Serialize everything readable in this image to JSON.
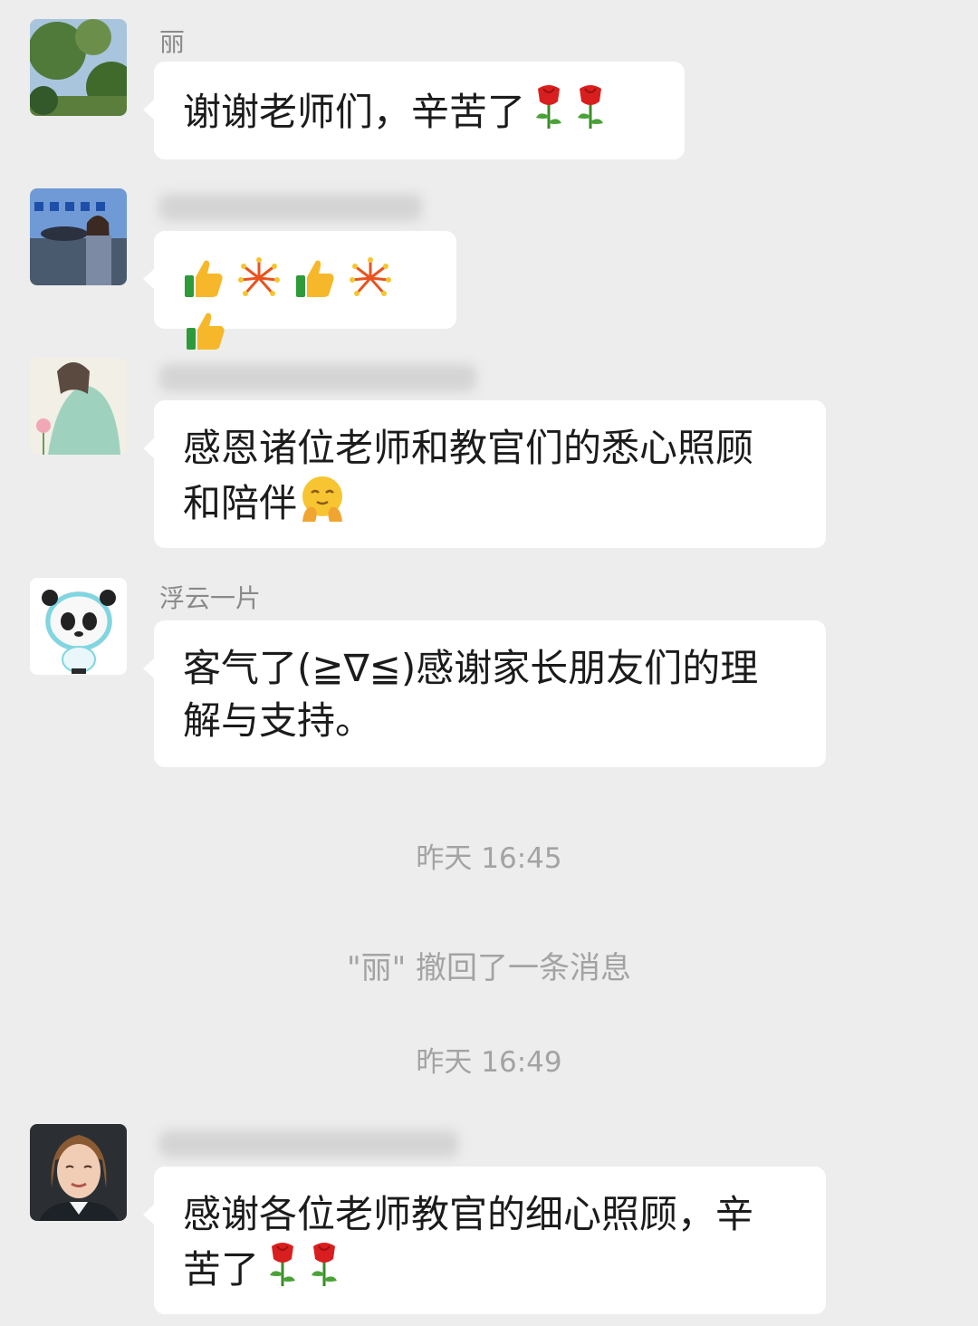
{
  "messages": [
    {
      "sender": "丽",
      "text": "谢谢老师们，辛苦了",
      "emojis": [
        "rose-emoji",
        "rose-emoji"
      ]
    },
    {
      "sender": "",
      "text": "",
      "emojis": [
        "thumbs-up-emoji",
        "fireworks-emoji",
        "thumbs-up-emoji",
        "fireworks-emoji",
        "thumbs-up-emoji"
      ]
    },
    {
      "sender": "",
      "text_line1": "感恩诸位老师和教官们的悉心照顾",
      "text_line2": "和陪伴",
      "emojis": [
        "hugging-face-emoji"
      ]
    },
    {
      "sender": "浮云一片",
      "text_line1": "客气了(≧∇≦)感谢家长朋友们的理",
      "text_line2": "解与支持。"
    },
    {
      "sender": "",
      "text_line1": "感谢各位老师教官的细心照顾，辛",
      "text_line2": "苦了",
      "emojis": [
        "rose-emoji",
        "rose-emoji"
      ]
    }
  ],
  "system": {
    "time1": "昨天 16:45",
    "recall": "\"丽\" 撤回了一条消息",
    "time2": "昨天 16:49"
  },
  "colors": {
    "background": "#ededed",
    "bubble": "#ffffff",
    "sender_text": "#8a8a8a",
    "system_text": "#a3a3a3"
  }
}
